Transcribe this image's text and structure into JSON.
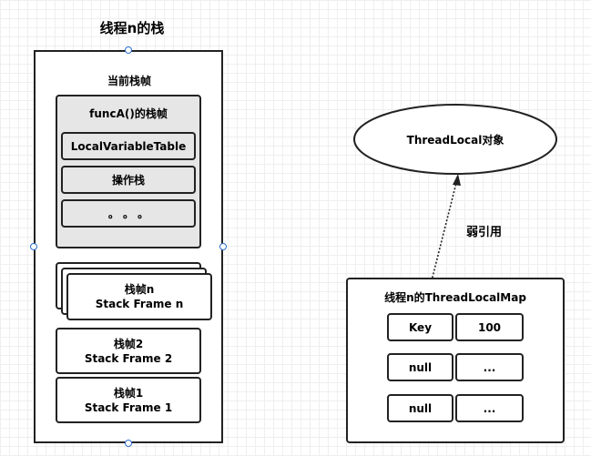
{
  "stack": {
    "title": "线程n的栈",
    "current_frame_label": "当前栈帧",
    "func_frame": {
      "title": "funcA()的栈帧",
      "rows": [
        "LocalVariableTable",
        "操作栈",
        "。 。 。"
      ]
    },
    "frame_n": {
      "line1": "栈帧n",
      "line2": "Stack Frame n"
    },
    "frame_2": {
      "line1": "栈帧2",
      "line2": "Stack Frame 2"
    },
    "frame_1": {
      "line1": "栈帧1",
      "line2": "Stack Frame 1"
    }
  },
  "threadlocal_object": "ThreadLocal对象",
  "weak_ref_label": "弱引用",
  "map": {
    "title": "线程n的ThreadLocalMap",
    "entries": [
      {
        "key": "Key",
        "value": "100"
      },
      {
        "key": "null",
        "value": "..."
      },
      {
        "key": "null",
        "value": "..."
      }
    ]
  },
  "colors": {
    "selection_handle": "#2a6ecf",
    "frame_fill": "#e6e6e6",
    "border": "#222222"
  }
}
